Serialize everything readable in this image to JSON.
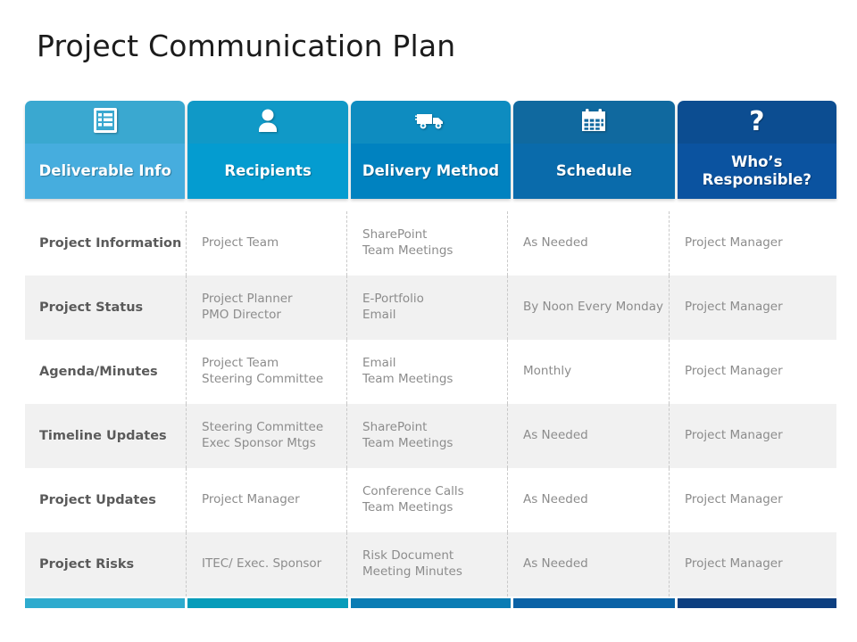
{
  "slide": {
    "title": "Project Communication Plan"
  },
  "colors": {
    "col0_top": "#3aa8d0",
    "col0_bottom": "#46adde",
    "col1_top": "#1099c7",
    "col1_bottom": "#049cd0",
    "col2_top": "#0e8cc0",
    "col2_bottom": "#0082c0",
    "col3_top": "#10699f",
    "col3_bottom": "#0a6bab",
    "col4_top": "#0c4d91",
    "col4_bottom": "#0b53a0",
    "foot0": "#2eabce",
    "foot1": "#069cba",
    "foot2": "#0a7cb4",
    "foot3": "#0a62a6",
    "foot4": "#0d3f80",
    "row_alt": "#f1f1f1",
    "label_text": "#5a5a5a",
    "value_text": "#8c8c8c",
    "divider": "#c9c9c9"
  },
  "header": {
    "columns": [
      {
        "label": "Deliverable Info",
        "icon": "checklist-document-icon"
      },
      {
        "label": "Recipients",
        "icon": "person-icon"
      },
      {
        "label": "Delivery Method",
        "icon": "delivery-truck-icon"
      },
      {
        "label": "Schedule",
        "icon": "calendar-icon"
      },
      {
        "label": "Who’s Responsible?",
        "icon": "question-mark-icon"
      }
    ]
  },
  "table": {
    "rows": [
      {
        "deliverable": "Project Information",
        "recipients": "Project Team",
        "delivery": "SharePoint\nTeam Meetings",
        "schedule": "As Needed",
        "responsible": "Project Manager"
      },
      {
        "deliverable": "Project Status",
        "recipients": "Project Planner\nPMO Director",
        "delivery": "E-Portfolio\nEmail",
        "schedule": "By Noon Every Monday",
        "responsible": "Project Manager"
      },
      {
        "deliverable": "Agenda/Minutes",
        "recipients": "Project Team\nSteering Committee",
        "delivery": "Email\nTeam Meetings",
        "schedule": "Monthly",
        "responsible": "Project Manager"
      },
      {
        "deliverable": "Timeline  Updates",
        "recipients": "Steering Committee\nExec Sponsor Mtgs",
        "delivery": "SharePoint\nTeam Meetings",
        "schedule": "As Needed",
        "responsible": "Project Manager"
      },
      {
        "deliverable": "Project Updates",
        "recipients": "Project Manager",
        "delivery": "Conference Calls\nTeam Meetings",
        "schedule": "As Needed",
        "responsible": "Project Manager"
      },
      {
        "deliverable": "Project Risks",
        "recipients": "ITEC/ Exec. Sponsor",
        "delivery": "Risk Document\nMeeting Minutes",
        "schedule": "As Needed",
        "responsible": "Project Manager"
      }
    ]
  }
}
